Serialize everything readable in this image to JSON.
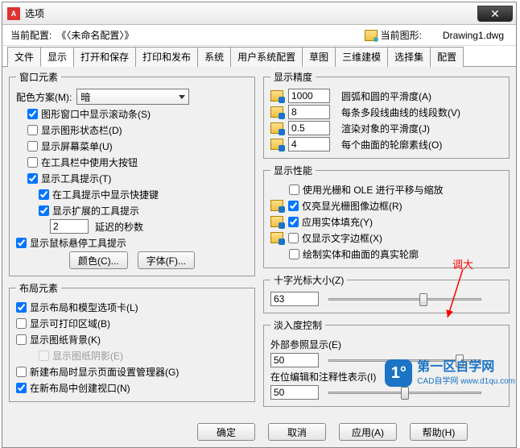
{
  "title": "选项",
  "top": {
    "profile_label": "当前配置:",
    "profile_value": "《〈未命名配置〉》",
    "drawing_label": "当前图形:",
    "drawing_value": "Drawing1.dwg"
  },
  "tabs": [
    "文件",
    "显示",
    "打开和保存",
    "打印和发布",
    "系统",
    "用户系统配置",
    "草图",
    "三维建模",
    "选择集",
    "配置"
  ],
  "active_tab": 1,
  "left": {
    "window": {
      "legend": "窗口元素",
      "scheme_label": "配色方案(M):",
      "scheme_value": "暗",
      "items": [
        {
          "checked": true,
          "label": "图形窗口中显示滚动条(S)"
        },
        {
          "checked": false,
          "label": "显示图形状态栏(D)"
        },
        {
          "checked": false,
          "label": "显示屏幕菜单(U)"
        },
        {
          "checked": false,
          "label": "在工具栏中使用大按钮"
        },
        {
          "checked": true,
          "label": "显示工具提示(T)"
        },
        {
          "checked": true,
          "label": "在工具提示中显示快捷键",
          "indent": 2
        },
        {
          "checked": true,
          "label": "显示扩展的工具提示",
          "indent": 2
        }
      ],
      "delay_value": "2",
      "delay_label": "延迟的秒数",
      "hover": {
        "checked": true,
        "label": "显示鼠标悬停工具提示"
      },
      "color_btn": "颜色(C)...",
      "font_btn": "字体(F)..."
    },
    "layout": {
      "legend": "布局元素",
      "items": [
        {
          "checked": true,
          "label": "显示布局和模型选项卡(L)"
        },
        {
          "checked": false,
          "label": "显示可打印区域(B)"
        },
        {
          "checked": false,
          "label": "显示图纸背景(K)"
        },
        {
          "checked": false,
          "label": "显示图纸阴影(E)",
          "disabled": true,
          "indent": 2
        },
        {
          "checked": false,
          "label": "新建布局时显示页面设置管理器(G)"
        },
        {
          "checked": true,
          "label": "在新布局中创建视口(N)"
        }
      ]
    }
  },
  "right": {
    "precision": {
      "legend": "显示精度",
      "rows": [
        {
          "value": "1000",
          "label": "圆弧和圆的平滑度(A)"
        },
        {
          "value": "8",
          "label": "每条多段线曲线的线段数(V)"
        },
        {
          "value": "0.5",
          "label": "渲染对象的平滑度(J)"
        },
        {
          "value": "4",
          "label": "每个曲面的轮廓素线(O)"
        }
      ]
    },
    "performance": {
      "legend": "显示性能",
      "items": [
        {
          "checked": false,
          "label": "使用光栅和 OLE 进行平移与缩放"
        },
        {
          "checked": true,
          "label": "仅亮显光栅图像边框(R)",
          "icon": true
        },
        {
          "checked": true,
          "label": "应用实体填充(Y)",
          "icon": true
        },
        {
          "checked": false,
          "label": "仅显示文字边框(X)",
          "icon": true
        },
        {
          "checked": false,
          "label": "绘制实体和曲面的真实轮廓"
        }
      ]
    },
    "cross": {
      "legend": "十字光标大小(Z)",
      "value": "63",
      "thumb_pct": 63
    },
    "fade": {
      "legend": "淡入度控制",
      "xref_label": "外部参照显示(E)",
      "xref_value": "50",
      "xref_thumb_pct": 88,
      "inplace_label": "在位编辑和注释性表示(I)",
      "inplace_value": "50",
      "inplace_thumb_pct": 50
    }
  },
  "annotation": "调大",
  "footer": {
    "ok": "确定",
    "cancel": "取消",
    "apply": "应用(A)",
    "help": "帮助(H)"
  },
  "watermark": {
    "title": "第一区自学网",
    "sub": "CAD自学网  www.d1qu.com"
  }
}
